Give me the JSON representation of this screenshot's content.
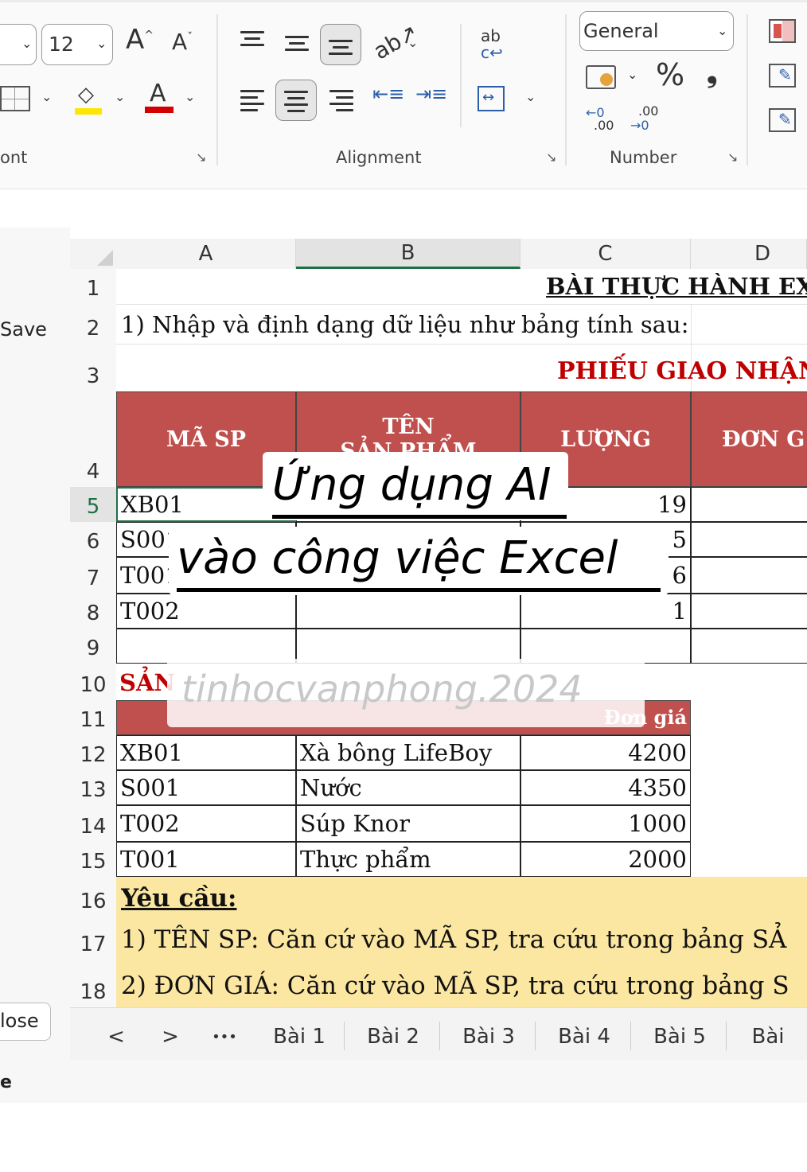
{
  "ribbon": {
    "font_size": "12",
    "font_group_label": "ont",
    "alignment_group_label": "Alignment",
    "number_group_label": "Number",
    "number_format": "General",
    "percent": "%",
    "comma": "❟",
    "increase_decimal": ".00",
    "decrease_decimal": ".00",
    "grow_font": "A",
    "shrink_font": "A",
    "font_color_letter": "A",
    "wrap_text": "ab"
  },
  "left_panel": {
    "save_label": "Save",
    "close_label": "lose",
    "bottom_label": "e"
  },
  "columns": [
    "A",
    "B",
    "C",
    "D"
  ],
  "rows": {
    "r1": {
      "num": "1",
      "title": "BÀI THỰC HÀNH EX"
    },
    "r2": {
      "num": "2",
      "text": "1) Nhập và định dạng dữ liệu như bảng tính sau:"
    },
    "r3": {
      "num": "3",
      "title": "PHIẾU GIAO NHẬN"
    },
    "r4": {
      "num": "4",
      "a": "MÃ SP",
      "b1": "TÊN",
      "b2": "SẢN PHẨM",
      "c": "LƯỢNG",
      "d": "ĐƠN G"
    },
    "r5": {
      "num": "5",
      "a": "XB01",
      "c": "19"
    },
    "r6": {
      "num": "6",
      "a": "S001",
      "c": "5"
    },
    "r7": {
      "num": "7",
      "a": "T001",
      "c": "6"
    },
    "r8": {
      "num": "8",
      "a": "T002",
      "c": "1"
    },
    "r9": {
      "num": "9"
    },
    "r10": {
      "num": "10",
      "a": "SẢN"
    },
    "r11": {
      "num": "11",
      "c": "Đơn giá"
    },
    "r12": {
      "num": "12",
      "a": "XB01",
      "b": "Xà bông LifeBoy",
      "c": "4200"
    },
    "r13": {
      "num": "13",
      "a": "S001",
      "b": "Nước",
      "c": "4350"
    },
    "r14": {
      "num": "14",
      "a": "T002",
      "b": "Súp Knor",
      "c": "1000"
    },
    "r15": {
      "num": "15",
      "a": "T001",
      "b": "Thực phẩm",
      "c": "2000"
    },
    "r16": {
      "num": "16",
      "text": "Yêu cầu:"
    },
    "r17": {
      "num": "17",
      "text": "1) TÊN SP: Căn cứ vào MÃ SP, tra cứu trong bảng SẢ"
    },
    "r18": {
      "num": "18",
      "text": "2) ĐƠN GIÁ: Căn cứ vào MÃ SP, tra cứu trong bảng S"
    }
  },
  "sheet_tabs": {
    "prev": "<",
    "next": ">",
    "more": "•••",
    "tabs": [
      "Bài 1",
      "Bài 2",
      "Bài 3",
      "Bài 4",
      "Bài 5",
      "Bài"
    ]
  },
  "overlay": {
    "line1": "Ứng dụng AI",
    "line2": "vào công việc Excel",
    "watermark": "tinhocvanphong.2024"
  },
  "colors": {
    "header_red": "#c0504d",
    "title_red": "#c00000",
    "note_yellow": "#fbe7a1",
    "font_color_bar": "#d40000",
    "highlight_bar": "#ffe600"
  }
}
